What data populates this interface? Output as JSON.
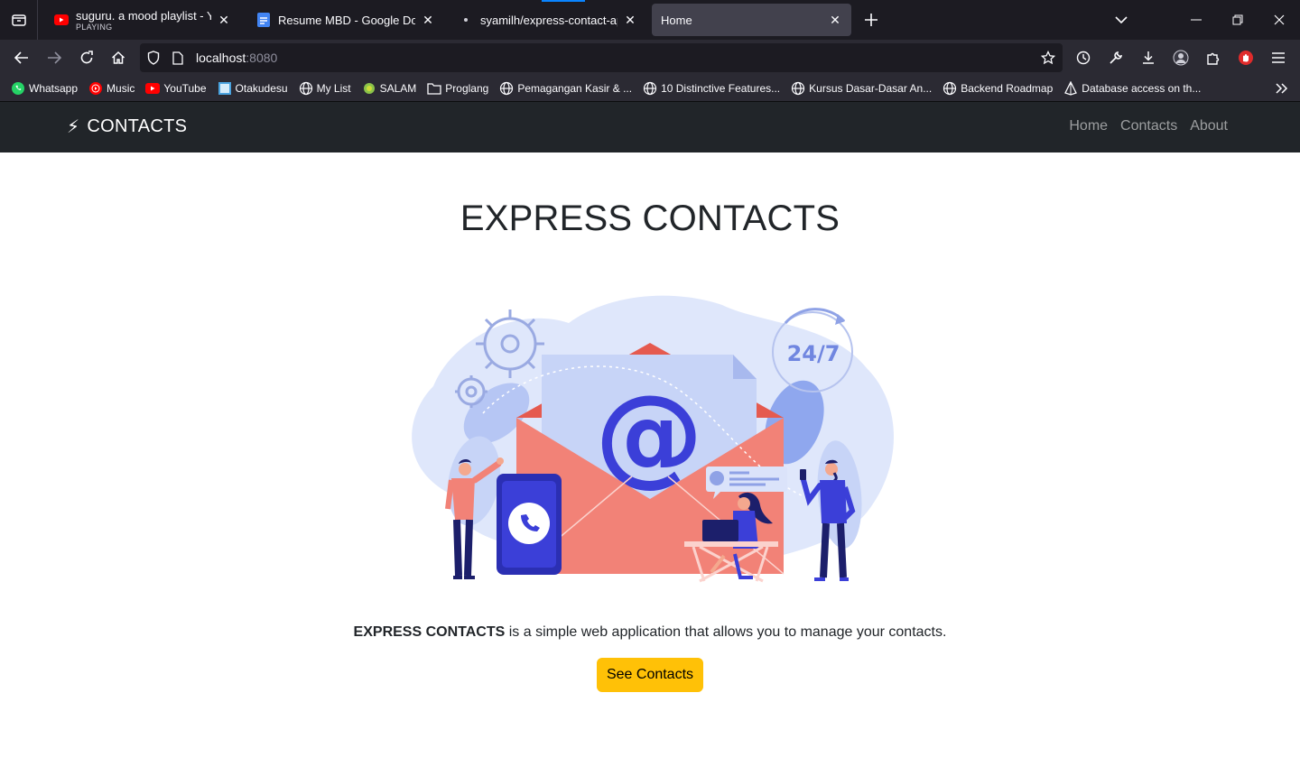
{
  "browser": {
    "tabs": [
      {
        "title": "suguru. a mood playlist - YouTu",
        "subtitle": "PLAYING",
        "icon": "youtube-icon"
      },
      {
        "title": "Resume MBD - Google Docs",
        "icon": "google-docs-icon"
      },
      {
        "title": "syamilh/express-contact-app: S",
        "icon": "github-icon"
      },
      {
        "title": "Home",
        "icon": "none",
        "active": true
      }
    ],
    "url": {
      "host": "localhost",
      "port": ":8080"
    },
    "bookmarks": [
      {
        "label": "Whatsapp",
        "icon": "whatsapp-icon"
      },
      {
        "label": "Music",
        "icon": "youtube-music-icon"
      },
      {
        "label": "YouTube",
        "icon": "youtube-icon"
      },
      {
        "label": "Otakudesu",
        "icon": "otakudesu-icon"
      },
      {
        "label": "My List",
        "icon": "globe-icon"
      },
      {
        "label": "SALAM",
        "icon": "salam-icon"
      },
      {
        "label": "Proglang",
        "icon": "folder-icon"
      },
      {
        "label": "Pemagangan Kasir & ...",
        "icon": "globe-icon"
      },
      {
        "label": "10 Distinctive Features...",
        "icon": "globe-icon"
      },
      {
        "label": "Kursus Dasar-Dasar An...",
        "icon": "globe-icon"
      },
      {
        "label": "Backend Roadmap",
        "icon": "globe-icon"
      },
      {
        "label": "Database access on th...",
        "icon": "prisma-icon"
      }
    ]
  },
  "site": {
    "brand": "CONTACTS",
    "brand_icon": "⚡",
    "nav": {
      "home": "Home",
      "contacts": "Contacts",
      "about": "About"
    },
    "hero_title": "EXPRESS CONTACTS",
    "illustration_text": {
      "at": "@",
      "hours": "24/7"
    },
    "lead_bold": "EXPRESS CONTACTS",
    "lead_rest": " is a simple web application that allows you to manage your contacts.",
    "cta": "See Contacts"
  },
  "colors": {
    "navbar": "#212529",
    "cta": "#ffc107",
    "envelope": "#f28277",
    "accent_blue": "#3b3fd8",
    "blob": "#dde6fb"
  }
}
